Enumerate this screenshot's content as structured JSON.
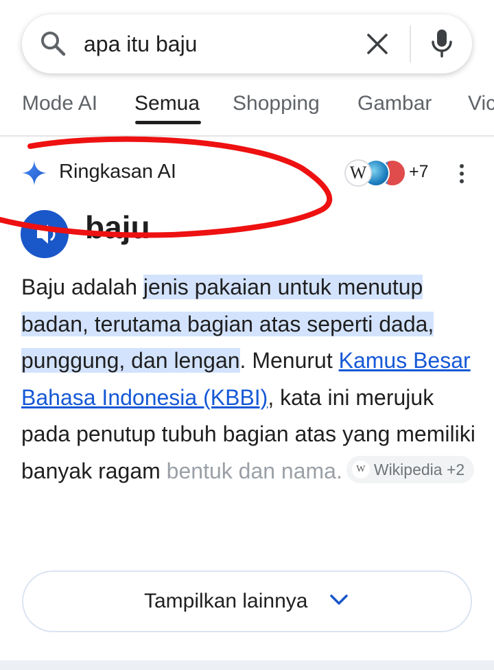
{
  "search": {
    "query": "apa itu baju"
  },
  "tabs": [
    {
      "label": "Mode AI",
      "active": false
    },
    {
      "label": "Semua",
      "active": true
    },
    {
      "label": "Shopping",
      "active": false
    },
    {
      "label": "Gambar",
      "active": false
    },
    {
      "label": "Vic",
      "active": false
    }
  ],
  "ai_overview": {
    "title": "Ringkasan AI",
    "source_icons": [
      "wikipedia-icon",
      "globe-icon",
      "book-icon"
    ],
    "sources_more": "+7",
    "entity_title": "baju",
    "paragraph": {
      "intro": "Baju adalah ",
      "highlight": "jenis pakaian untuk menutup badan, terutama bagian atas seperti dada, punggung, dan lengan",
      "after_highlight": ". Menurut ",
      "link": "Kamus Besar Bahasa Indonesia (KBBI)",
      "after_link": ", kata ini merujuk pada penutup tubuh bagian atas yang memiliki banyak ragam ",
      "faded": "bentuk dan nama.",
      "chip_icon": "W",
      "chip_label": "Wikipedia +2"
    },
    "show_more_label": "Tampilkan lainnya"
  },
  "colors": {
    "accent_blue": "#1a57c9",
    "highlight": "#d3e3fd",
    "link": "#1558d6",
    "annotation_red": "#ee1111"
  }
}
